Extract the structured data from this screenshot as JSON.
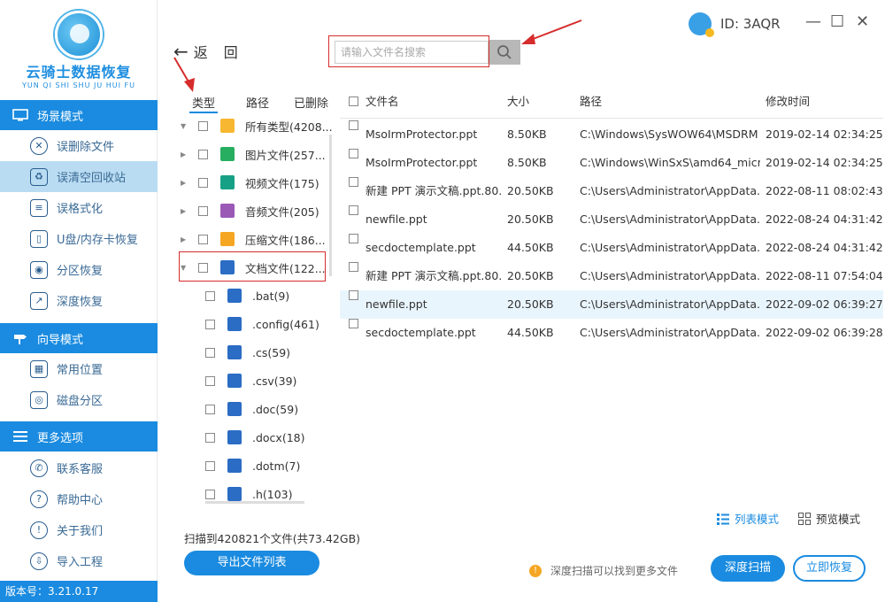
{
  "app": {
    "logo_title": "云骑士数据恢复",
    "logo_sub": "YUN QI SHI SHU JU HUI FU",
    "version": "版本号：3.21.0.17"
  },
  "sidebar": {
    "sections": [
      {
        "title": "场景模式",
        "items": [
          {
            "label": "误删除文件",
            "icon": "trash-file-icon"
          },
          {
            "label": "误清空回收站",
            "icon": "recycle-bin-icon",
            "active": true
          },
          {
            "label": "误格式化",
            "icon": "format-icon"
          },
          {
            "label": "U盘/内存卡恢复",
            "icon": "usb-icon"
          },
          {
            "label": "分区恢复",
            "icon": "partition-icon"
          },
          {
            "label": "深度恢复",
            "icon": "deep-recovery-icon"
          }
        ]
      },
      {
        "title": "向导模式",
        "items": [
          {
            "label": "常用位置",
            "icon": "location-icon"
          },
          {
            "label": "磁盘分区",
            "icon": "disk-icon"
          }
        ]
      },
      {
        "title": "更多选项",
        "items": [
          {
            "label": "联系客服",
            "icon": "support-icon"
          },
          {
            "label": "帮助中心",
            "icon": "help-icon"
          },
          {
            "label": "关于我们",
            "icon": "info-icon"
          },
          {
            "label": "导入工程",
            "icon": "import-icon"
          }
        ]
      }
    ]
  },
  "header": {
    "back": "返",
    "back2": "回",
    "search_placeholder": "请输入文件名搜索",
    "user_id": "ID: 3AQR",
    "minimize": "—",
    "maximize": "☐",
    "close": "✕"
  },
  "tree": {
    "tabs": [
      "类型",
      "路径",
      "已删除"
    ],
    "rows": [
      {
        "label": "所有类型(4208...",
        "expanded": true,
        "level": 0,
        "icon": "folder-icon",
        "color": "#f7b731"
      },
      {
        "label": "图片文件(257...",
        "level": 1,
        "icon": "image-icon",
        "color": "#27ae60"
      },
      {
        "label": "视频文件(175)",
        "level": 1,
        "icon": "video-icon",
        "color": "#16a085"
      },
      {
        "label": "音频文件(205)",
        "level": 1,
        "icon": "audio-icon",
        "color": "#9b59b6"
      },
      {
        "label": "压缩文件(186...",
        "level": 1,
        "icon": "archive-icon",
        "color": "#f5a623"
      },
      {
        "label": "文档文件(122...",
        "level": 1,
        "expanded": true,
        "icon": "document-icon",
        "color": "#2b6cc4"
      },
      {
        "label": ".bat(9)",
        "level": 2,
        "icon": "doc-file-icon",
        "color": "#2b6cc4"
      },
      {
        "label": ".config(461)",
        "level": 2,
        "icon": "doc-file-icon",
        "color": "#2b6cc4"
      },
      {
        "label": ".cs(59)",
        "level": 2,
        "icon": "doc-file-icon",
        "color": "#2b6cc4"
      },
      {
        "label": ".csv(39)",
        "level": 2,
        "icon": "doc-file-icon",
        "color": "#2b6cc4"
      },
      {
        "label": ".doc(59)",
        "level": 2,
        "icon": "doc-file-icon",
        "color": "#2b6cc4"
      },
      {
        "label": ".docx(18)",
        "level": 2,
        "icon": "doc-file-icon",
        "color": "#2b6cc4"
      },
      {
        "label": ".dotm(7)",
        "level": 2,
        "icon": "doc-file-icon",
        "color": "#2b6cc4"
      },
      {
        "label": ".h(103)",
        "level": 2,
        "icon": "doc-file-icon",
        "color": "#2b6cc4"
      }
    ]
  },
  "table": {
    "headers": {
      "name": "文件名",
      "size": "大小",
      "path": "路径",
      "modified": "修改时间"
    },
    "rows": [
      {
        "name": "MsoIrmProtector.ppt",
        "size": "8.50KB",
        "path": "C:\\Windows\\SysWOW64\\MSDRM",
        "modified": "2019-02-14 02:34:25"
      },
      {
        "name": "MsoIrmProtector.ppt",
        "size": "8.50KB",
        "path": "C:\\Windows\\WinSxS\\amd64_micr...",
        "modified": "2019-02-14 02:34:25"
      },
      {
        "name": "新建 PPT 演示文稿.ppt.80...",
        "size": "20.50KB",
        "path": "C:\\Users\\Administrator\\AppData...",
        "modified": "2022-08-11 08:02:43"
      },
      {
        "name": "newfile.ppt",
        "size": "20.50KB",
        "path": "C:\\Users\\Administrator\\AppData...",
        "modified": "2022-08-24 04:31:42"
      },
      {
        "name": "secdoctemplate.ppt",
        "size": "44.50KB",
        "path": "C:\\Users\\Administrator\\AppData...",
        "modified": "2022-08-24 04:31:42"
      },
      {
        "name": "新建 PPT 演示文稿.ppt.80...",
        "size": "20.50KB",
        "path": "C:\\Users\\Administrator\\AppData...",
        "modified": "2022-08-11 07:54:04"
      },
      {
        "name": "newfile.ppt",
        "size": "20.50KB",
        "path": "C:\\Users\\Administrator\\AppData...",
        "modified": "2022-09-02 06:39:27",
        "selected": true
      },
      {
        "name": "secdoctemplate.ppt",
        "size": "44.50KB",
        "path": "C:\\Users\\Administrator\\AppData...",
        "modified": "2022-09-02 06:39:28"
      }
    ]
  },
  "footer": {
    "list_mode": "列表模式",
    "preview_mode": "预览模式",
    "scan_info": "扫描到420821个文件(共73.42GB)",
    "export_btn": "导出文件列表",
    "tip": "深度扫描可以找到更多文件",
    "deep_scan_btn": "深度扫描",
    "recover_btn": "立即恢复"
  },
  "colors": {
    "accent": "#1a8be0",
    "annotation": "#d62c2c"
  }
}
